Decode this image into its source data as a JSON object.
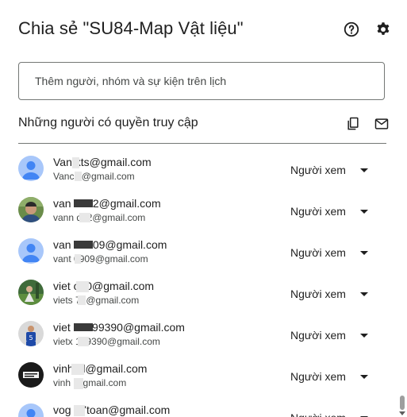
{
  "dialog": {
    "title": "Chia sẻ \"SU84-Map Vật liệu\"",
    "help_icon": "help-circle-icon",
    "settings_icon": "gear-icon"
  },
  "search": {
    "placeholder": "Thêm người, nhóm và sự kiện trên lịch",
    "value": ""
  },
  "access_section": {
    "title": "Những người có quyền truy cập",
    "copy_icon": "copy-icon",
    "email_icon": "mail-icon"
  },
  "people": [
    {
      "email": "Van     kts@gmail.com",
      "sub": "Vanc     s@gmail.com",
      "role": "Người xem",
      "avatar": "default"
    },
    {
      "email": "van     hd92@gmail.com",
      "sub": "vann     d92@gmail.com",
      "role": "Người xem",
      "avatar": "photo"
    },
    {
      "email": "van     n0909@gmail.com",
      "sub": "vant     0909@gmail.com",
      "role": "Người xem",
      "avatar": "default"
    },
    {
      "email": "viet     o70@gmail.com",
      "sub": "viets     70@gmail.com",
      "role": "Người xem",
      "avatar": "photo"
    },
    {
      "email": "viet     en199390@gmail.com",
      "sub": "vietx     199390@gmail.com",
      "role": "Người xem",
      "avatar": "photo"
    },
    {
      "email": "vinh     al@gmail.com",
      "sub": "vinh     @gmail.com",
      "role": "Người xem",
      "avatar": "logo"
    },
    {
      "email": "vog     47toan@gmail.com",
      "sub": "",
      "role": "Người xem",
      "avatar": "default"
    }
  ],
  "colors": {
    "default_avatar_bg": "#a8c7fa",
    "default_avatar_fg": "#4285f4",
    "text_primary": "#1f1f1f",
    "text_secondary": "#444746"
  }
}
